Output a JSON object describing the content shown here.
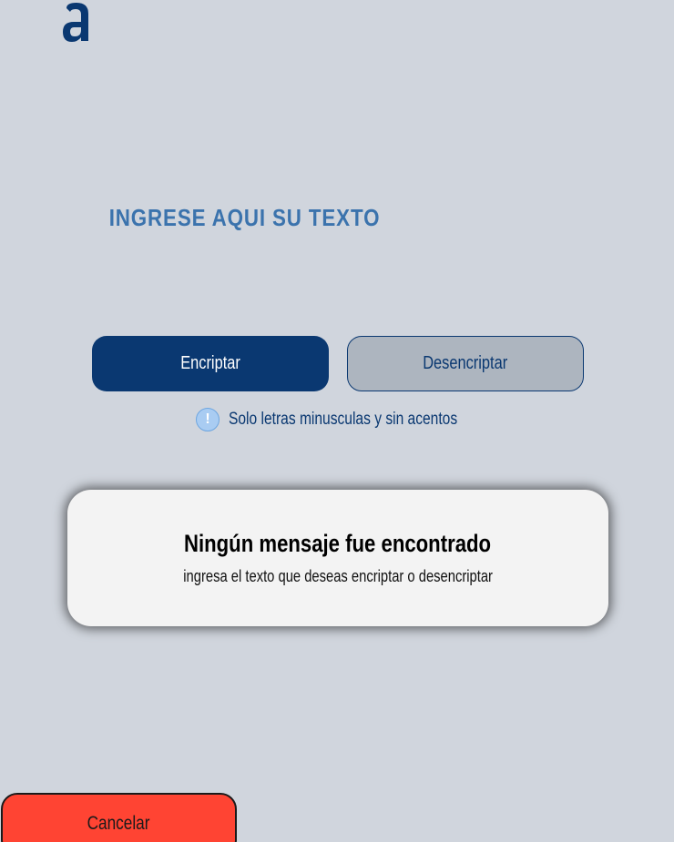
{
  "logo": {
    "icon": "alura-a-logo-icon",
    "color": "#0a3871"
  },
  "input": {
    "placeholder": "INGRESE AQUI SU TEXTO",
    "value": ""
  },
  "buttons": {
    "encrypt_label": "Encriptar",
    "decrypt_label": "Desencriptar",
    "cancel_label": "Cancelar"
  },
  "hint": {
    "icon": "info-exclamation-icon",
    "icon_glyph": "!",
    "text": "Solo letras minusculas y sin acentos"
  },
  "result": {
    "title": "Ningún mensaje fue encontrado",
    "subtitle": "ingresa el texto que deseas encriptar o desencriptar"
  },
  "colors": {
    "background": "#d0d5dd",
    "primary": "#0a3871",
    "placeholder": "#3b73ad",
    "secondary_button": "#adb5bf",
    "card": "#f3f3f3",
    "cancel": "#ff4433"
  }
}
